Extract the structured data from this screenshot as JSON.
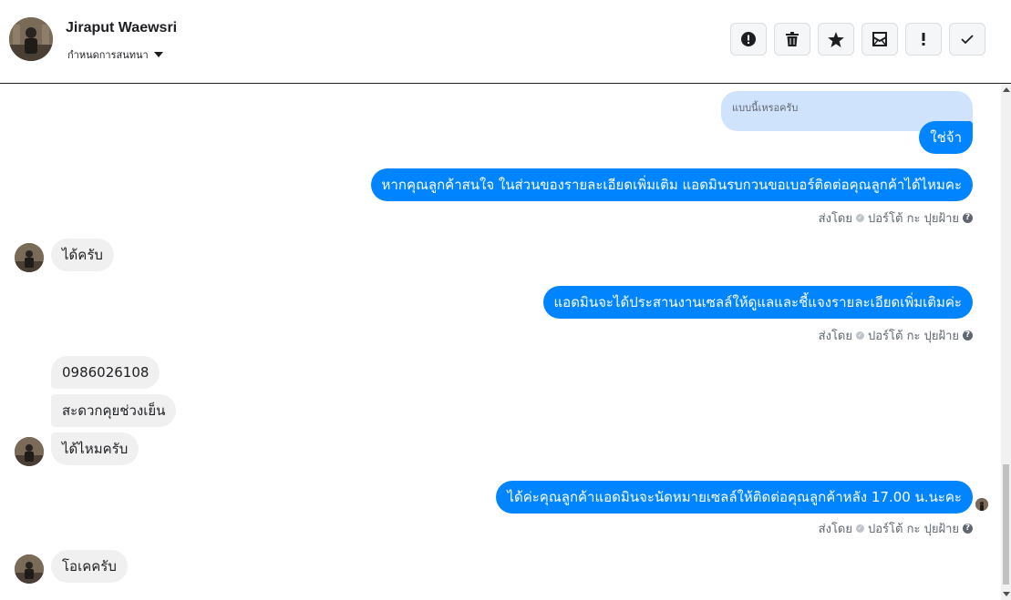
{
  "header": {
    "name": "Jiraput Waewsri",
    "subtitle": "กำหนดการสนทนา",
    "actions": [
      {
        "name": "report-button",
        "icon": "alert-circle-icon"
      },
      {
        "name": "delete-button",
        "icon": "trash-icon"
      },
      {
        "name": "star-button",
        "icon": "star-icon"
      },
      {
        "name": "mark-unread-button",
        "icon": "envelope-icon"
      },
      {
        "name": "important-button",
        "icon": "exclamation-icon"
      },
      {
        "name": "done-button",
        "icon": "check-icon"
      }
    ]
  },
  "conversation": {
    "quoted_text": "แบบนี้เหรอครับ",
    "messages": [
      {
        "side": "out",
        "text": "ใช่จ้า"
      },
      {
        "side": "out",
        "text": "หากคุณลูกค้าสนใจ ในส่วนของรายละเอียดเพิ่มเติม แอดมินรบกวนขอเบอร์ติดต่อคุณลูกค้าได้ไหมคะ"
      },
      {
        "side": "in",
        "text": "ได้ครับ"
      },
      {
        "side": "out",
        "text": "แอดมินจะได้ประสานงานเซลล์ให้ดูแลและชี้แจงรายละเอียดเพิ่มเติมค่ะ"
      },
      {
        "side": "in",
        "text": "0986026108"
      },
      {
        "side": "in",
        "text": "สะดวกคุยช่วงเย็น"
      },
      {
        "side": "in",
        "text": "ได้ไหมครับ"
      },
      {
        "side": "out",
        "text": "ได้ค่ะคุณลูกค้าแอดมินจะนัดหมายเซลล์ให้ติดต่อคุณลูกค้าหลัง 17.00 น.นะคะ"
      },
      {
        "side": "in",
        "text": "โอเคครับ"
      }
    ],
    "sent_by_prefix": "ส่งโดย",
    "sent_by_name": "ปอร์โต้ กะ ปุยฝ้าย"
  },
  "colors": {
    "outgoing_bubble": "#0084ff",
    "incoming_bubble": "#f0f0f0",
    "quote_bubble": "#cfe3fd"
  }
}
